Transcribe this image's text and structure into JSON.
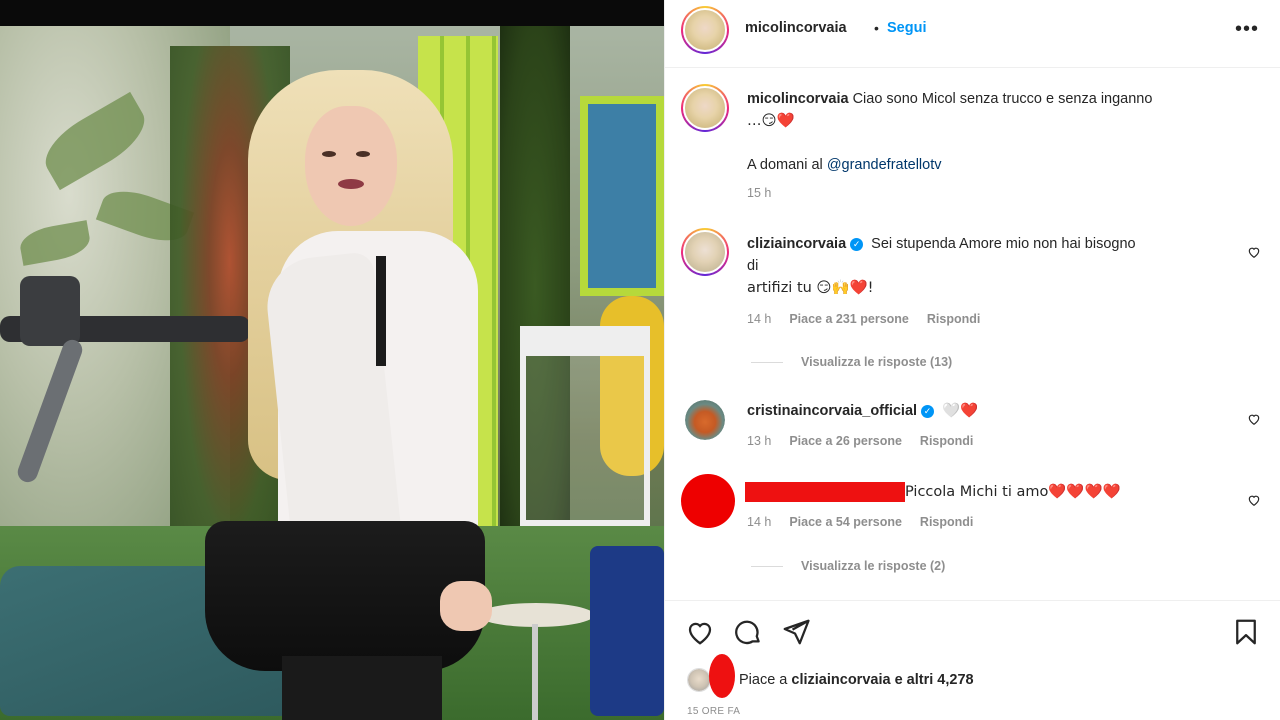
{
  "post": {
    "author": "micolincorvaia",
    "follow_label": "Segui",
    "separator": "•",
    "more_label": "•••",
    "caption_line1": "Ciao sono Micol senza trucco e senza inganno",
    "caption_line2": "…😏❤️",
    "caption_line3_prefix": "A domani al ",
    "caption_mention": "@grandefratellotv",
    "caption_time": "15 h"
  },
  "comments": [
    {
      "username": "cliziaincorvaia",
      "verified": true,
      "text_line1": "Sei stupenda Amore mio non hai bisogno",
      "text_line2": "di",
      "text_line3": "artifizi tu 😏🙌❤️!",
      "time": "14 h",
      "likes": "Piace a 231 persone",
      "reply_label": "Rispondi",
      "view_replies": "Visualizza le risposte (13)"
    },
    {
      "username": "cristinaincorvaia_official",
      "verified": true,
      "text": "🤍❤️",
      "time": "13 h",
      "likes": "Piace a 26 persone",
      "reply_label": "Rispondi"
    },
    {
      "username": "",
      "text": "Piccola Michi ti amo❤️❤️❤️❤️",
      "time": "14 h",
      "likes": "Piace a 54 persone",
      "reply_label": "Rispondi",
      "view_replies": "Visualizza le risposte (2)"
    }
  ],
  "footer": {
    "likes_prefix": "Piace a ",
    "likes_user": "cliziaincorvaia",
    "likes_suffix": " e altri 4,278",
    "time_ago": "15 ORE FA"
  },
  "colors": {
    "link_blue": "#0095f6",
    "mention": "#00376b",
    "secondary_text": "#8e8e8e",
    "redaction": "#ee1111"
  },
  "icons": {
    "like": "heart-icon",
    "comment": "comment-icon",
    "share": "paper-plane-icon",
    "save": "bookmark-icon",
    "verified": "verified-badge-icon"
  }
}
